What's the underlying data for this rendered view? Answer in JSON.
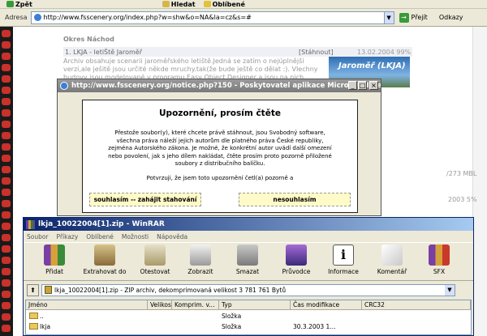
{
  "browser": {
    "toolbar": {
      "back": "Zpět",
      "search": "Hledat",
      "favorites": "Oblíbené"
    },
    "address": {
      "label": "Adresa",
      "url": "http://www.fsscenery.org/index.php?w=shw&o=NA&la=cz&s=#",
      "go": "Přejít",
      "links": "Odkazy"
    }
  },
  "webpage": {
    "okres": "Okres Náchod",
    "row_title": "1. LKJA - letiŠtě Jaroměř",
    "download": "[Stáhnout]",
    "date": "13.02.2004 99%",
    "desc": "Archiv obsahuje scenarii jaroměřského letiště.Jedná se zatím o nejúplnější verzi,ale ješitě jsou určité někde mruchy.tak(že bude ještě co dělat :). VIechny budovy jsou modelované v programu Easy Object Designer a jsou na nich fotorealistické",
    "image_caption": "Jaroměř (LKJA)",
    "side_num_1": "/273 MBL",
    "side_num_2": "2003 5%"
  },
  "popup": {
    "title": "http://www.fsscenery.org/notice.php?150 - Poskytovatel aplikace Microsoft Intern...",
    "heading": "Upozornění, prosím čtěte",
    "body": "Přestože soubor(y), které chcete právě stáhnout, jsou Svobodný software, všechna práva náleží jejich autorům dle platného práva České republiky, zejména Autorského zákona. Je možné, že konkrétní autor uvádí další omezení nebo povolení, jak s jeho dílem nakládat, čtěte prosím proto pozorně přiložené soubory z distribučního balíčku.",
    "confirm": "Potvrzuji, že jsem toto upozornění četl(a) pozorně a",
    "accept": "souhlasím -- zahájit stahování",
    "decline": "nesouhlasím"
  },
  "winrar": {
    "title": "lkja_10022004[1].zip - WinRAR",
    "menu": [
      "Soubor",
      "Příkazy",
      "Oblíbené",
      "Možnosti",
      "Nápověda"
    ],
    "tools": [
      "Přidat",
      "Extrahovat do",
      "Otestovat",
      "Zobrazit",
      "Smazat",
      "Průvodce",
      "Informace",
      "Komentář",
      "SFX"
    ],
    "path": "lkja_10022004[1].zip - ZIP archiv, dekomprimovaná velikost 3 781 761 Bytů",
    "columns": [
      "Jméno",
      "Velikost",
      "Komprim. v...",
      "Typ",
      "Čas modifikace",
      "CRC32"
    ],
    "rows": [
      {
        "name": "..",
        "size": "",
        "packed": "",
        "type": "Složka",
        "modified": "",
        "crc": ""
      },
      {
        "name": "lkja",
        "size": "",
        "packed": "",
        "type": "Složka",
        "modified": "30.3.2003 1...",
        "crc": ""
      }
    ]
  },
  "colors": {
    "accent_title": "#0a246a",
    "strip_dot": "#c8322a",
    "button_bg": "#fffbc8"
  }
}
